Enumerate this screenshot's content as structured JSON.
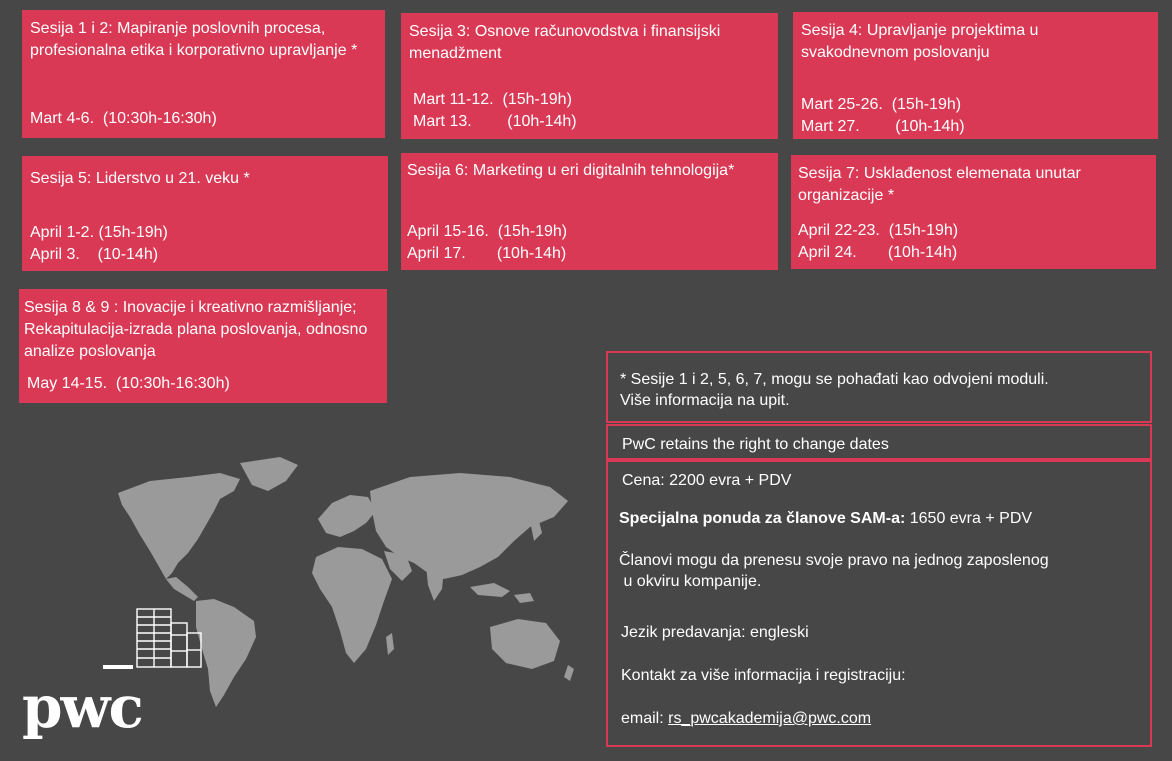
{
  "sessions": [
    {
      "title": "Sesija 1 i 2: Mapiranje poslovnih procesa, profesionalna etika i korporativno upravljanje *",
      "dates": [
        "Mart 4-6.  (10:30h-16:30h)"
      ]
    },
    {
      "title": "Sesija 3: Osnove računovodstva i finansijski menadžment",
      "dates": [
        "Mart 11-12.  (15h-19h)",
        "Mart 13.        (10h-14h)"
      ]
    },
    {
      "title": "Sesija 4: Upravljanje projektima u svakodnevnom poslovanju",
      "dates": [
        "Mart 25-26.  (15h-19h)",
        "Mart 27.        (10h-14h)"
      ]
    },
    {
      "title": "Sesija 5: Liderstvo u 21. veku *",
      "dates": [
        "April 1-2. (15h-19h)",
        "April 3.    (10-14h)"
      ]
    },
    {
      "title": "Sesija 6: Marketing u eri digitalnih tehnologija*",
      "dates": [
        "April 15-16.  (15h-19h)",
        "April 17.       (10h-14h)"
      ]
    },
    {
      "title": "Sesija 7: Usklađenost elemenata unutar organizacije *",
      "dates": [
        "April 22-23.  (15h-19h)",
        "April 24.       (10h-14h)"
      ]
    },
    {
      "title": "Sesija 8 & 9 : Inovacije i kreativno razmišljanje; Rekapitulacija-izrada plana poslovanja, odnosno analize poslovanja",
      "dates": [
        "May 14-15.  (10:30h-16:30h)"
      ]
    }
  ],
  "info": {
    "modules_note": "* Sesije 1 i 2, 5, 6, 7,  mogu se pohađati kao odvojeni moduli.",
    "more_info": "Više informacija na upit.",
    "rights_note": "PwC retains the right to change dates",
    "price": "Cena:  2200 evra + PDV",
    "special_label": "Specijalna ponuda za članove SAM-a:",
    "special_price": " 1650  evra + PDV",
    "members_line1": "Članovi mogu da prenesu svoje pravo na jednog zaposlenog",
    "members_line2": " u okviru kompanije.",
    "language": "Jezik predavanja: engleski",
    "contact": "Kontakt za više informacija i registraciju:",
    "email_label": "email: ",
    "email": "rs_pwcakademija@pwc.com"
  },
  "logo": {
    "text": "pwc"
  },
  "colors": {
    "background": "#474747",
    "accent": "#d93954",
    "map": "#9a9a9a"
  }
}
